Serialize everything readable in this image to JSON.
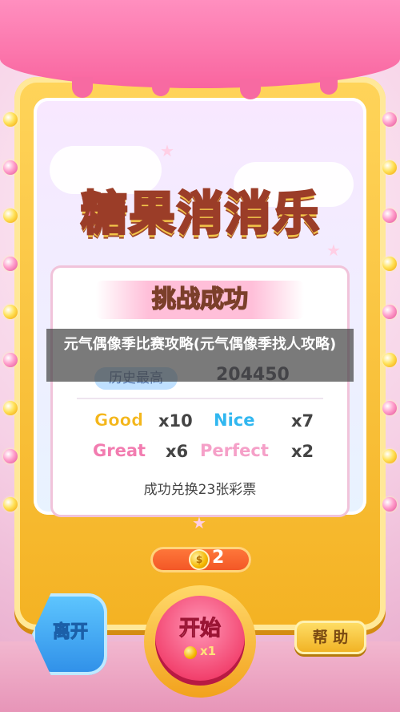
{
  "game": {
    "logo_text": "糖果消消乐"
  },
  "result": {
    "title": "挑战成功",
    "history_label": "历史最高",
    "score": "204450",
    "grades": [
      {
        "label": "Good",
        "multiplier": "x10",
        "color": "#f4b61a"
      },
      {
        "label": "Nice",
        "multiplier": "x7",
        "color": "#31b7f0"
      },
      {
        "label": "Great",
        "multiplier": "x6",
        "color": "#f27cb0"
      },
      {
        "label": "Perfect",
        "multiplier": "x2",
        "color": "#f5a0c8"
      }
    ],
    "exchange_text": "成功兑换23张彩票"
  },
  "coins": {
    "count": "2"
  },
  "buttons": {
    "leave": "离开",
    "start": "开始",
    "start_cost": "x1",
    "help": "帮 助"
  },
  "overlay": {
    "caption": "元气偶像季比赛攻略(元气偶像季找人攻略)"
  },
  "colors": {
    "frame": "#f4b223",
    "canopy": "#f9659f",
    "start_button": "#f2416d",
    "leave_button": "#2f8fe8"
  }
}
